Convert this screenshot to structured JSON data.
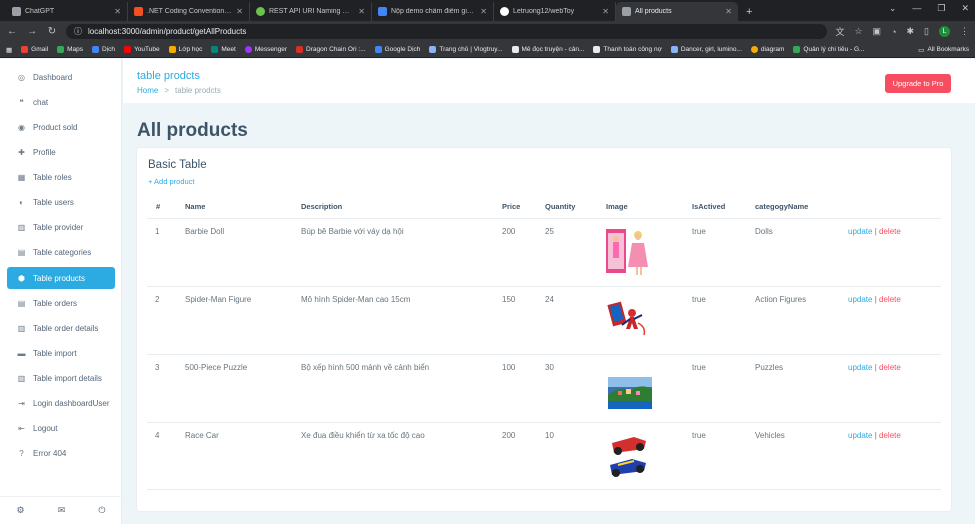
{
  "browser": {
    "tabs": [
      {
        "title": "ChatGPT",
        "color": "#9aa0a6",
        "active": false
      },
      {
        "title": ".NET Coding Conventions - C#",
        "color": "#f25022",
        "active": false
      },
      {
        "title": "REST API URI Naming Conventi...",
        "color": "#6cc24a",
        "active": false
      },
      {
        "title": "Nộp demo chấm điểm giữa kỳ",
        "color": "#4285f4",
        "active": false
      },
      {
        "title": "Letruong12/webToy",
        "color": "#ffffff",
        "active": false
      },
      {
        "title": "All products",
        "color": "#9aa0a6",
        "active": true
      }
    ],
    "url": "localhost:3000/admin/product/getAllProducts",
    "bookmarks": [
      {
        "label": "Gmail",
        "color": "#ea4335"
      },
      {
        "label": "Maps",
        "color": "#34a853"
      },
      {
        "label": "Dịch",
        "color": "#4285f4"
      },
      {
        "label": "YouTube",
        "color": "#ff0000"
      },
      {
        "label": "Lớp học",
        "color": "#f9ab00"
      },
      {
        "label": "Meet",
        "color": "#00897b"
      },
      {
        "label": "Messenger",
        "color": "#a033ff"
      },
      {
        "label": "Dragon Chain Ori :...",
        "color": "#d93025"
      },
      {
        "label": "Google Dịch",
        "color": "#4285f4"
      },
      {
        "label": "Trang chủ | Vlogtruy...",
        "color": "#8ab4f8"
      },
      {
        "label": "Mê đọc truyện - cản...",
        "color": "#e8eaed"
      },
      {
        "label": "Thanh toán công nợ",
        "color": "#e8eaed"
      },
      {
        "label": "Dancer, girl, lumino...",
        "color": "#8ab4f8"
      },
      {
        "label": "diagram",
        "color": "#f9ab00"
      },
      {
        "label": "Quản lý chi tiêu - G...",
        "color": "#34a853"
      }
    ],
    "all_bookmarks": "All Bookmarks",
    "profile_initial": "L"
  },
  "sidebar": {
    "items": [
      {
        "label": "Dashboard",
        "icon": "dashboard-icon",
        "glyph": "◎"
      },
      {
        "label": "chat",
        "icon": "chat-icon",
        "glyph": "❝"
      },
      {
        "label": "Product sold",
        "icon": "product-sold-icon",
        "glyph": "◉"
      },
      {
        "label": "Profile",
        "icon": "profile-icon",
        "glyph": "✚"
      },
      {
        "label": "Table roles",
        "icon": "table-icon",
        "glyph": "▦"
      },
      {
        "label": "Table users",
        "icon": "users-icon",
        "glyph": "◐"
      },
      {
        "label": "Table provider",
        "icon": "provider-icon",
        "glyph": "▥"
      },
      {
        "label": "Table categories",
        "icon": "categories-icon",
        "glyph": "▤"
      },
      {
        "label": "Table products",
        "icon": "products-icon",
        "glyph": "⬢"
      },
      {
        "label": "Table orders",
        "icon": "orders-icon",
        "glyph": "▤"
      },
      {
        "label": "Table order details",
        "icon": "order-details-icon",
        "glyph": "▥"
      },
      {
        "label": "Table import",
        "icon": "import-icon",
        "glyph": "▬"
      },
      {
        "label": "Table import details",
        "icon": "import-details-icon",
        "glyph": "▥"
      },
      {
        "label": "Login dashboardUser",
        "icon": "login-icon",
        "glyph": "⇥"
      },
      {
        "label": "Logout",
        "icon": "logout-icon",
        "glyph": "⇤"
      },
      {
        "label": "Error 404",
        "icon": "error-icon",
        "glyph": "?"
      }
    ],
    "active_index": 8
  },
  "header": {
    "title": "table prodcts",
    "breadcrumb_home": "Home",
    "breadcrumb_sep": ">",
    "breadcrumb_current": "table prodcts",
    "upgrade_label": "Upgrade to Pro"
  },
  "main": {
    "title": "All products",
    "card_title": "Basic Table",
    "add_label": "+ Add product",
    "columns": [
      "#",
      "Name",
      "Description",
      "Price",
      "Quantity",
      "Image",
      "IsActived",
      "categogyName"
    ],
    "rows": [
      {
        "id": "1",
        "name": "Barbie Doll",
        "description": "Búp bê Barbie với váy dạ hội",
        "price": "200",
        "quantity": "25",
        "image": "barbie-doll-image",
        "isActived": "true",
        "category": "Dolls"
      },
      {
        "id": "2",
        "name": "Spider-Man Figure",
        "description": "Mô hình Spider-Man cao 15cm",
        "price": "150",
        "quantity": "24",
        "image": "spider-man-figure-image",
        "isActived": "true",
        "category": "Action Figures"
      },
      {
        "id": "3",
        "name": "500-Piece Puzzle",
        "description": "Bộ xếp hình 500 mảnh về cảnh biển",
        "price": "100",
        "quantity": "30",
        "image": "puzzle-image",
        "isActived": "true",
        "category": "Puzzles"
      },
      {
        "id": "4",
        "name": "Race Car",
        "description": "Xe đua điều khiển từ xa tốc độ cao",
        "price": "200",
        "quantity": "10",
        "image": "race-car-image",
        "isActived": "true",
        "category": "Vehicles"
      }
    ],
    "update_label": "update",
    "separator": "|",
    "delete_label": "delete"
  }
}
